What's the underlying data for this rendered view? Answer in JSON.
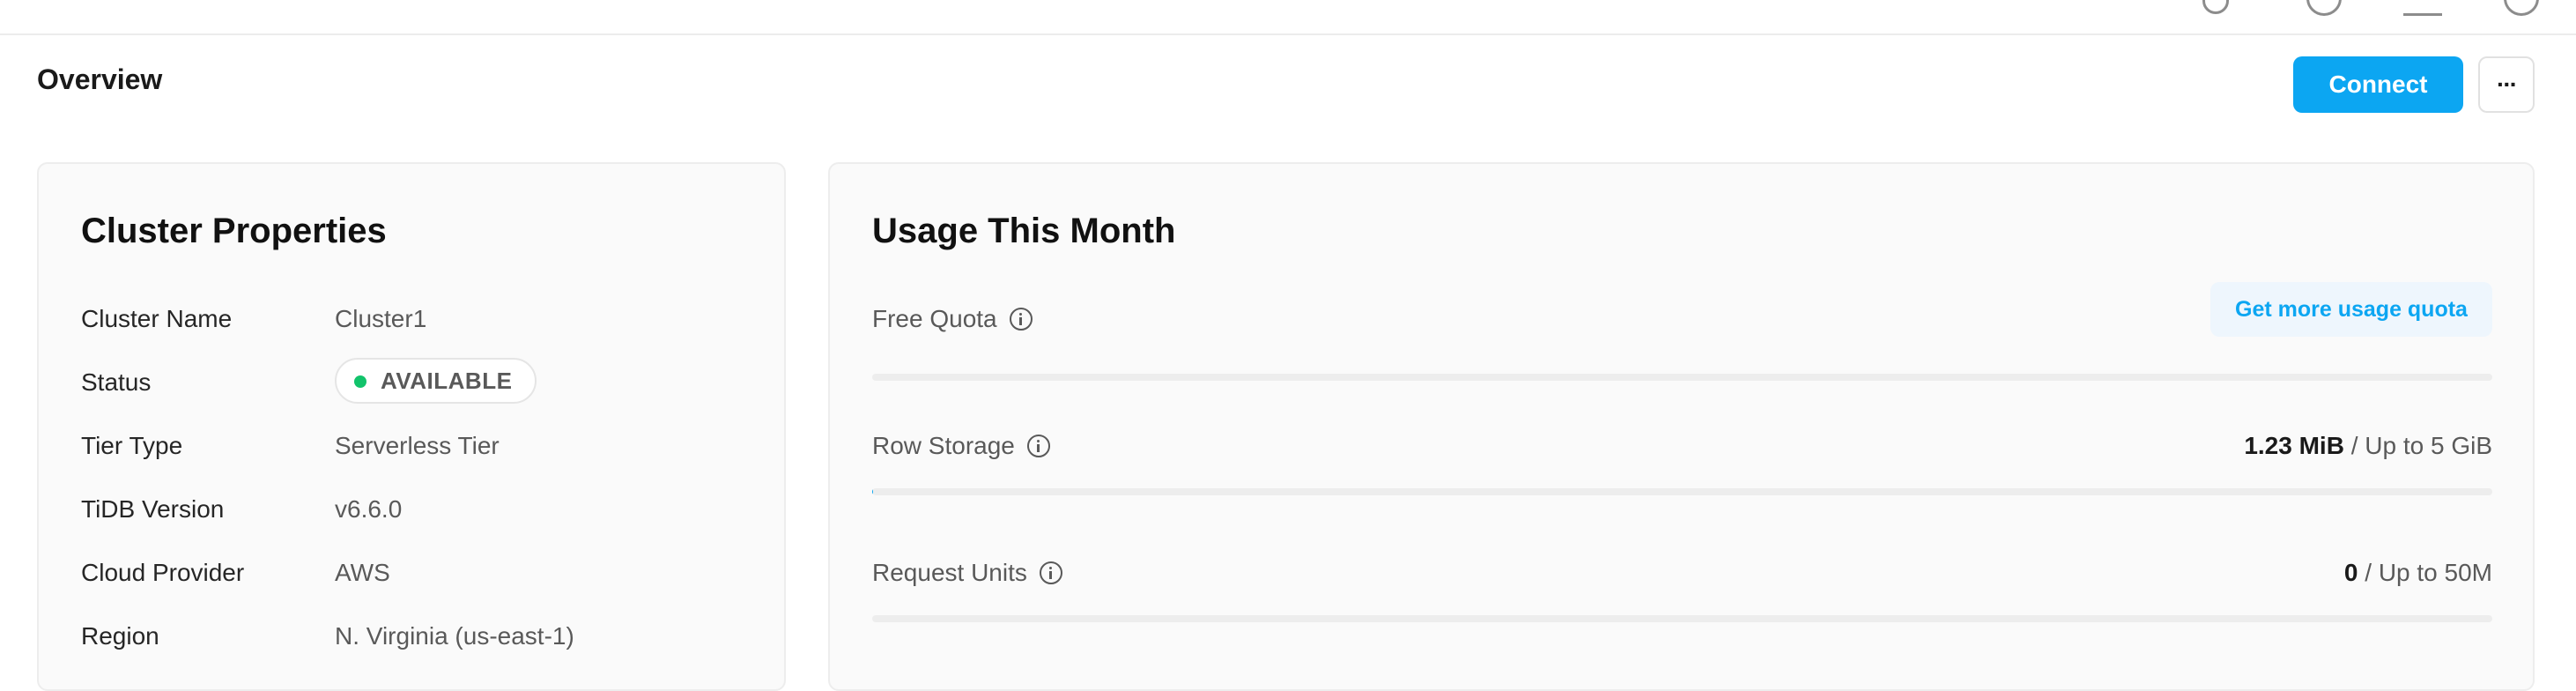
{
  "header": {
    "title": "Overview",
    "connect_label": "Connect",
    "more_label": "···"
  },
  "cluster_properties": {
    "title": "Cluster Properties",
    "rows": [
      {
        "label": "Cluster Name",
        "value": "Cluster1"
      },
      {
        "label": "Status",
        "value": "AVAILABLE"
      },
      {
        "label": "Tier Type",
        "value": "Serverless Tier"
      },
      {
        "label": "TiDB Version",
        "value": "v6.6.0"
      },
      {
        "label": "Cloud Provider",
        "value": "AWS"
      },
      {
        "label": "Region",
        "value": "N. Virginia (us-east-1)"
      }
    ]
  },
  "usage": {
    "title": "Usage This Month",
    "free_quota": {
      "label": "Free Quota",
      "button_label": "Get more usage quota",
      "progress": 0
    },
    "row_storage": {
      "label": "Row Storage",
      "used": "1.23 MiB",
      "limit": " / Up to 5 GiB",
      "progress": 0.0002
    },
    "request_units": {
      "label": "Request Units",
      "used": "0",
      "limit": " / Up to 50M",
      "progress": 0
    }
  },
  "colors": {
    "accent": "#0ca6f2",
    "status_available": "#12c36b"
  }
}
